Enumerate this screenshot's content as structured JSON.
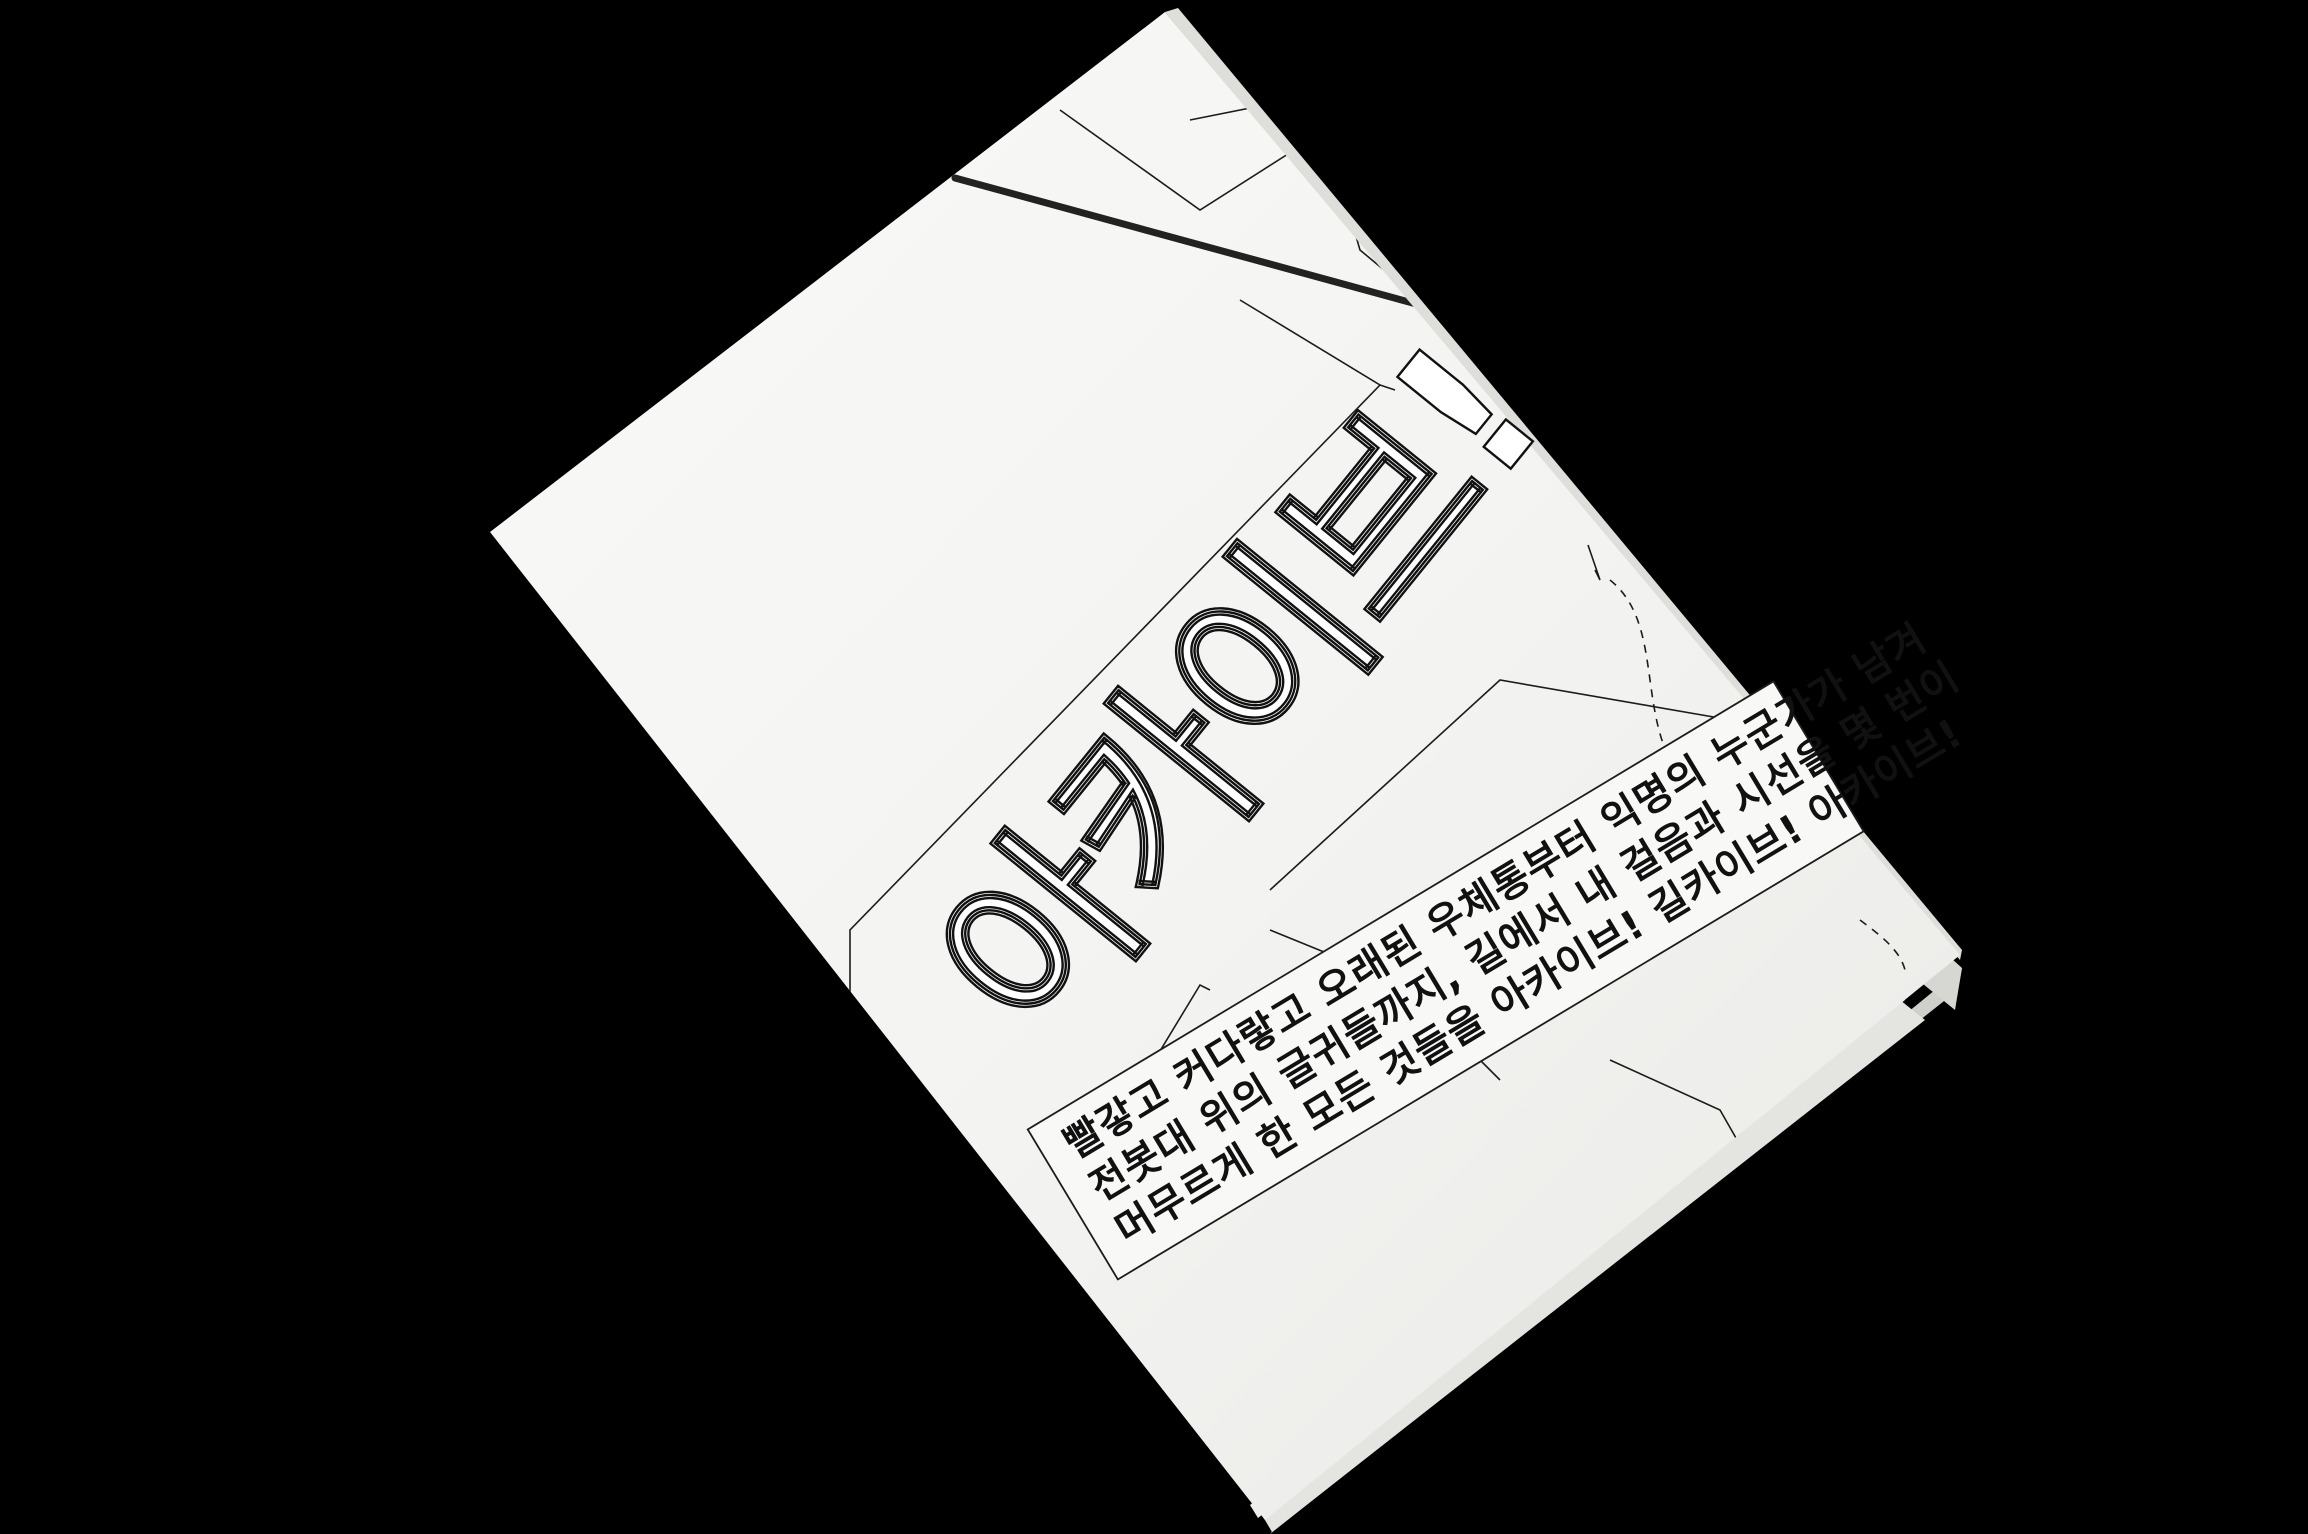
{
  "book": {
    "title": "아카이브!",
    "blurb_lines": [
      "빨갛고 커다랗고 오래된 우체통부터 익명의 누군가가 남겨",
      "전봇대 위의 글귀들까지, 길에서 내 걸음과 시선을 몇 번이",
      "머무르게 한 모든 것들을 아카이브! 길카이브! 아카이브!"
    ]
  },
  "colors": {
    "background": "#000000",
    "paper": "#f7f7f5",
    "paper_shadow": "#d9d9d6",
    "line": "#1c1c1c",
    "accent_bar": "#222222"
  }
}
